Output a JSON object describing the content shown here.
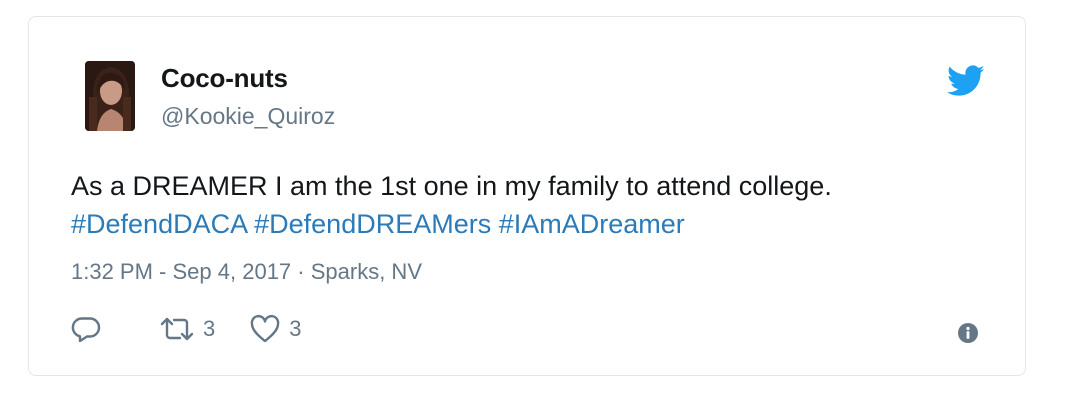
{
  "user": {
    "display_name": "Coco-nuts",
    "handle": "@Kookie_Quiroz"
  },
  "tweet": {
    "text": "As a DREAMER I am the 1st one in my family to attend college.",
    "hashtags": [
      "#DefendDACA",
      "#DefendDREAMers",
      "#IAmADreamer"
    ]
  },
  "meta": {
    "time": "1:32 PM",
    "separator1": " - ",
    "date": "Sep 4, 2017",
    "separator2": " · ",
    "location": "Sparks, NV"
  },
  "actions": {
    "retweet_count": "3",
    "like_count": "3"
  },
  "icons": {
    "logo": "twitter-bird-icon",
    "reply": "reply-icon",
    "retweet": "retweet-icon",
    "like": "heart-icon",
    "info": "info-icon"
  },
  "colors": {
    "brand": "#1da1f2",
    "link": "#2b7bb9",
    "text": "#14171a",
    "muted": "#657786",
    "border": "#e1e8ed"
  }
}
